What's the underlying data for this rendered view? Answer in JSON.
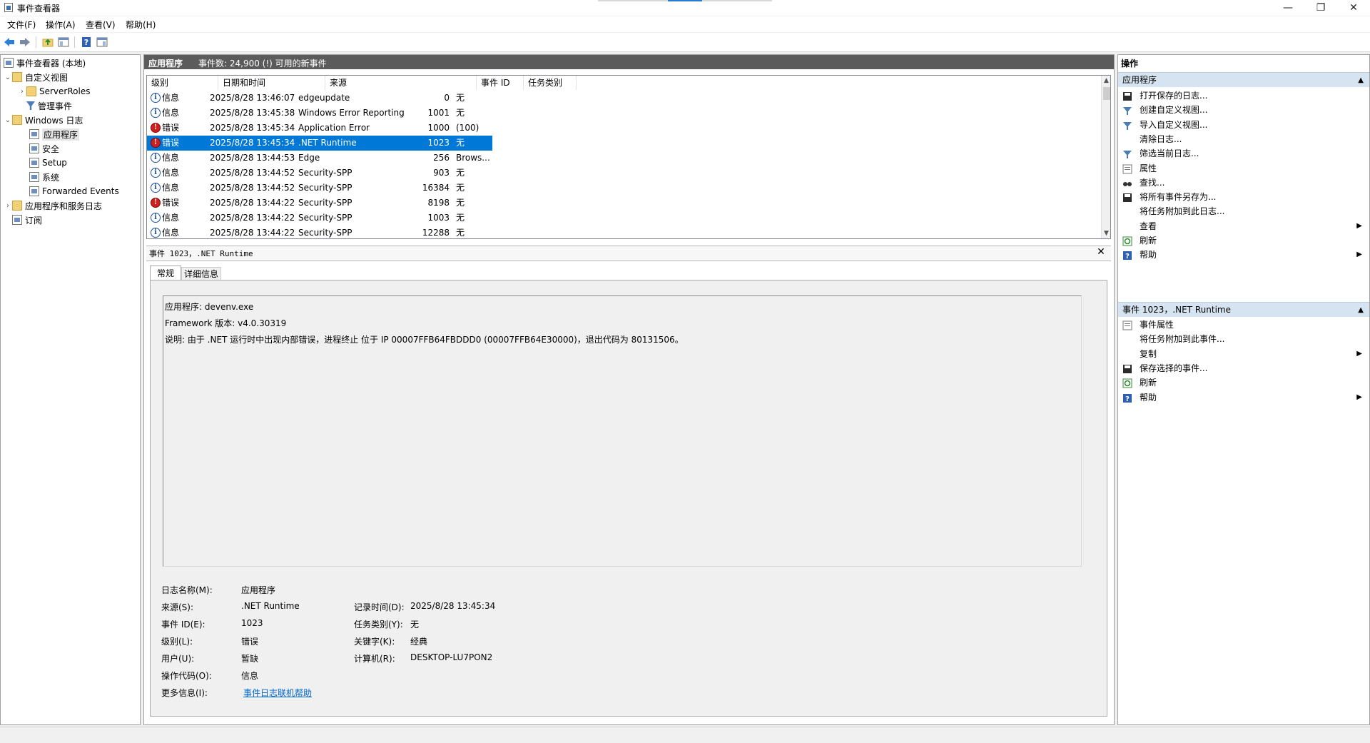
{
  "window": {
    "title": "事件查看器",
    "minimize_glyph": "—",
    "restore_glyph": "❐",
    "close_glyph": "✕"
  },
  "menu": [
    "文件(F)",
    "操作(A)",
    "查看(V)",
    "帮助(H)"
  ],
  "tree": {
    "root": "事件查看器 (本地)",
    "custom_views": "自定义视图",
    "server_roles": "ServerRoles",
    "admin_events": "管理事件",
    "windows_logs": "Windows 日志",
    "application": "应用程序",
    "security": "安全",
    "setup": "Setup",
    "system": "系统",
    "forwarded": "Forwarded Events",
    "app_service_logs": "应用程序和服务日志",
    "subscriptions": "订阅"
  },
  "center_header": {
    "name": "应用程序",
    "count": "事件数: 24,900 (!) 可用的新事件"
  },
  "columns": [
    "级别",
    "日期和时间",
    "来源",
    "事件 ID",
    "任务类别"
  ],
  "events": [
    {
      "level": "信息",
      "kind": "info",
      "datetime": "2025/8/28 13:46:07",
      "source": "edgeupdate",
      "id": "0",
      "task": "无"
    },
    {
      "level": "信息",
      "kind": "info",
      "datetime": "2025/8/28 13:45:38",
      "source": "Windows Error Reporting",
      "id": "1001",
      "task": "无"
    },
    {
      "level": "错误",
      "kind": "error",
      "datetime": "2025/8/28 13:45:34",
      "source": "Application Error",
      "id": "1000",
      "task": "(100)"
    },
    {
      "level": "错误",
      "kind": "error",
      "datetime": "2025/8/28 13:45:34",
      "source": ".NET Runtime",
      "id": "1023",
      "task": "无",
      "selected": true
    },
    {
      "level": "信息",
      "kind": "info",
      "datetime": "2025/8/28 13:44:53",
      "source": "Edge",
      "id": "256",
      "task": "Brows..."
    },
    {
      "level": "信息",
      "kind": "info",
      "datetime": "2025/8/28 13:44:52",
      "source": "Security-SPP",
      "id": "903",
      "task": "无"
    },
    {
      "level": "信息",
      "kind": "info",
      "datetime": "2025/8/28 13:44:52",
      "source": "Security-SPP",
      "id": "16384",
      "task": "无"
    },
    {
      "level": "错误",
      "kind": "error",
      "datetime": "2025/8/28 13:44:22",
      "source": "Security-SPP",
      "id": "8198",
      "task": "无"
    },
    {
      "level": "信息",
      "kind": "info",
      "datetime": "2025/8/28 13:44:22",
      "source": "Security-SPP",
      "id": "1003",
      "task": "无"
    },
    {
      "level": "信息",
      "kind": "info",
      "datetime": "2025/8/28 13:44:22",
      "source": "Security-SPP",
      "id": "12288",
      "task": "无"
    }
  ],
  "detail": {
    "title": "事件 1023，.NET Runtime",
    "tab_general": "常规",
    "tab_details": "详细信息",
    "desc_line1": "应用程序: devenv.exe",
    "desc_line2": "Framework 版本: v4.0.30319",
    "desc_line3": "说明: 由于 .NET 运行时中出现内部错误，进程终止 位于 IP 00007FFB64FBDDD0 (00007FFB64E30000)，退出代码为 80131506。",
    "log_name_label": "日志名称(M):",
    "log_name": "应用程序",
    "source_label": "来源(S):",
    "source": ".NET Runtime",
    "logged_label": "记录时间(D):",
    "logged": "2025/8/28 13:45:34",
    "event_id_label": "事件 ID(E):",
    "event_id": "1023",
    "task_label": "任务类别(Y):",
    "task": "无",
    "level_label": "级别(L):",
    "level": "错误",
    "keywords_label": "关键字(K):",
    "keywords": "经典",
    "user_label": "用户(U):",
    "user": "暂缺",
    "computer_label": "计算机(R):",
    "computer": "DESKTOP-LU7PON2",
    "opcode_label": "操作代码(O):",
    "opcode": "信息",
    "more_info_label": "更多信息(I):",
    "more_info": "事件日志联机帮助"
  },
  "actions": {
    "title": "操作",
    "section1": "应用程序",
    "items1": [
      "打开保存的日志...",
      "创建自定义视图...",
      "导入自定义视图...",
      "清除日志...",
      "筛选当前日志...",
      "属性",
      "查找...",
      "将所有事件另存为...",
      "将任务附加到此日志...",
      "查看",
      "刷新",
      "帮助"
    ],
    "section2": "事件 1023，.NET Runtime",
    "items2": [
      "事件属性",
      "将任务附加到此事件...",
      "复制",
      "保存选择的事件...",
      "刷新",
      "帮助"
    ]
  },
  "colors": {
    "selection": "#0078d7",
    "header_bg": "#5b5b5b",
    "section_bg": "#d6e3f0",
    "link": "#0066cc",
    "error": "#d01f1f"
  }
}
